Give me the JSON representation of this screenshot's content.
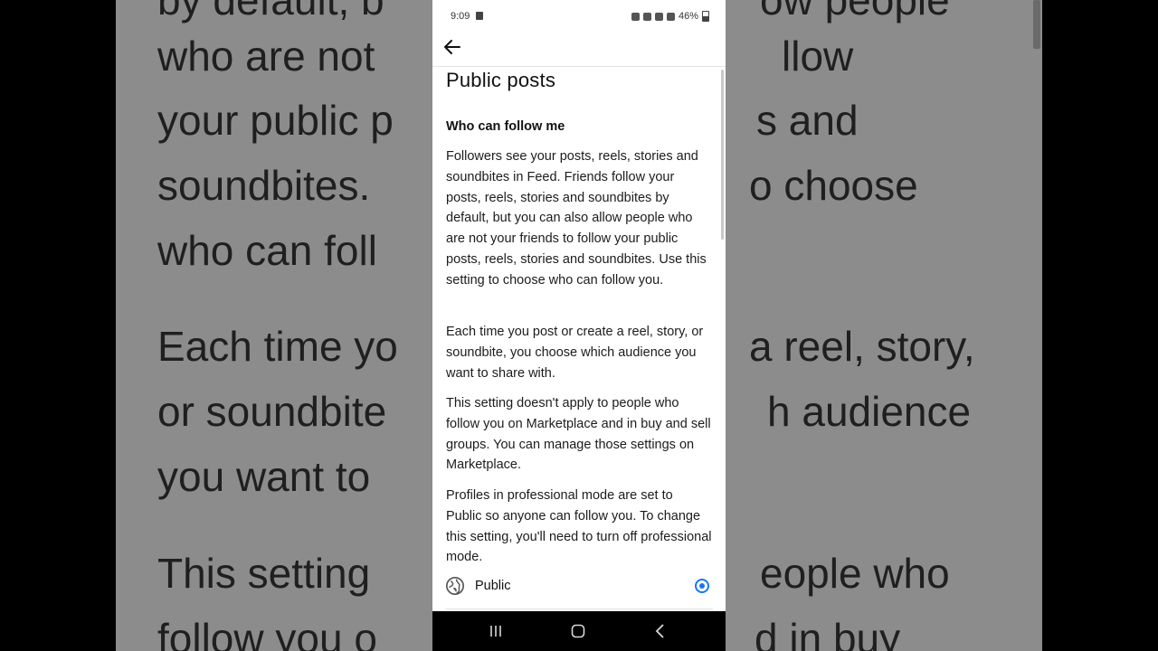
{
  "background": {
    "lines": [
      {
        "text": "by default, b",
        "right": "ow people"
      },
      {
        "text": "who are not",
        "right": "llow"
      },
      {
        "text": "your public p",
        "right": "s and"
      },
      {
        "text": "soundbites.",
        "right": "o choose"
      },
      {
        "text": "who can foll",
        "right": ""
      },
      {
        "text": "Each time yo",
        "right": "a reel, story,"
      },
      {
        "text": "or soundbite",
        "right": "h audience"
      },
      {
        "text": "you want to",
        "right": ""
      },
      {
        "text": "This setting",
        "right": "eople who"
      },
      {
        "text": "follow you o",
        "right": "d in buy"
      }
    ]
  },
  "statusbar": {
    "time": "9:09",
    "battery": "46%"
  },
  "page": {
    "title": "Public posts",
    "section_title": "Who can follow me",
    "paragraphs": [
      "Followers see your posts, reels, stories and soundbites in Feed. Friends follow your posts, reels, stories and soundbites by default, but you can also allow people who are not your friends to follow your public posts, reels, stories and soundbites. Use this setting to choose who can follow you.",
      "Each time you post or create a reel, story, or soundbite, you choose which audience you want to share with.",
      "This setting doesn't apply to people who follow you on Marketplace and in buy and sell groups. You can manage those settings on Marketplace.",
      "Profiles in professional mode are set to Public so anyone can follow you. To change this setting, you'll need to turn off professional mode."
    ],
    "options": [
      {
        "label": "Public",
        "icon": "globe-icon",
        "selected": true
      }
    ]
  },
  "colors": {
    "accent": "#1877f2"
  }
}
